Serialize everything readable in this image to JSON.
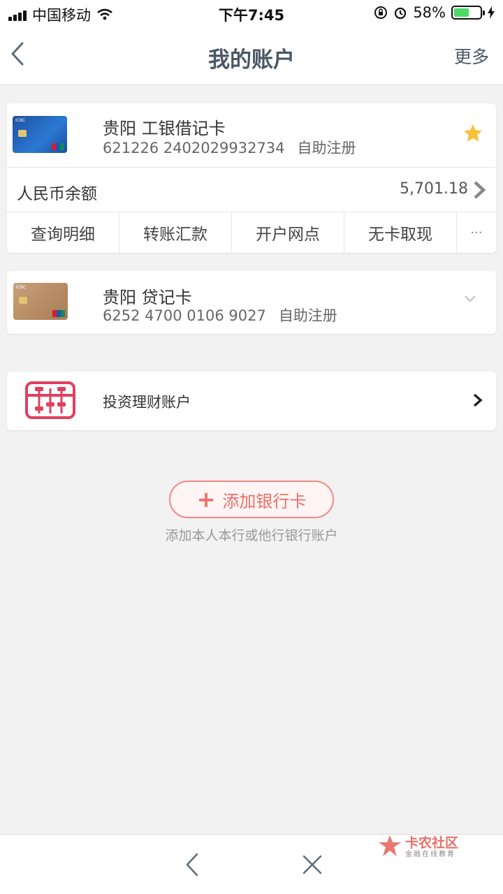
{
  "status_bar": {
    "carrier": "中国移动",
    "time": "下午7:45",
    "battery_percent": "58%",
    "battery_level": 0.58
  },
  "nav": {
    "title": "我的账户",
    "more": "更多"
  },
  "accounts": [
    {
      "name": "贵阳 工银借记卡",
      "number": "621226 2402029932734",
      "registration": "自助注册",
      "favorite": true,
      "balance_label": "人民币余额",
      "balance": "5,701.18",
      "actions": [
        "查询明细",
        "转账汇款",
        "开户网点",
        "无卡取现",
        "···"
      ]
    },
    {
      "name": "贵阳 贷记卡",
      "number": "6252 4700 0106 9027",
      "registration": "自助注册"
    }
  ],
  "investment": {
    "label": "投资理财账户"
  },
  "add_card": {
    "button": "添加银行卡",
    "hint": "添加本人本行或他行银行账户"
  },
  "watermark": {
    "brand": "卡农社区",
    "sub": "金融在线教育"
  },
  "colors": {
    "accent": "#ee6f6a",
    "star": "#f7c23b",
    "nav_text": "#4a5866"
  }
}
